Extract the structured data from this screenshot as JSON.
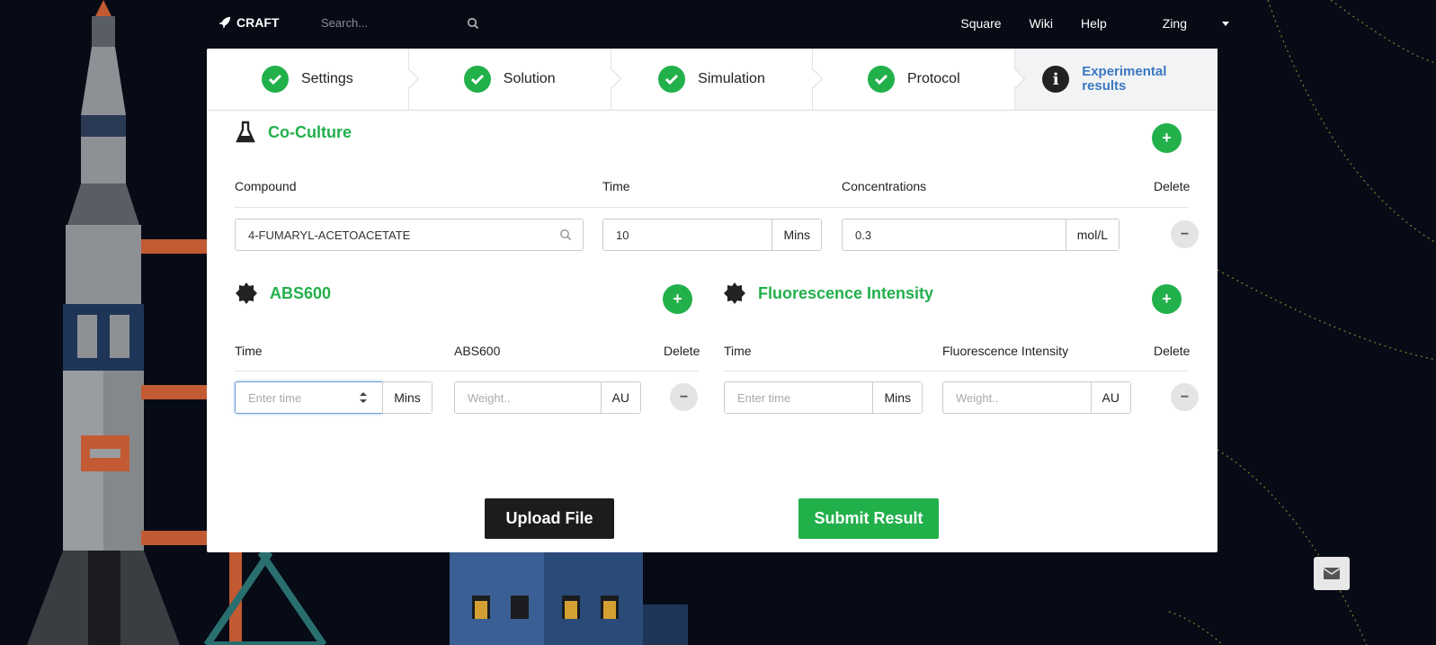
{
  "nav": {
    "brand": "CRAFT",
    "search_placeholder": "Search...",
    "links": [
      "Square",
      "Wiki",
      "Help"
    ],
    "user": "Zing"
  },
  "steps": [
    {
      "label": "Settings",
      "status": "done"
    },
    {
      "label": "Solution",
      "status": "done"
    },
    {
      "label": "Simulation",
      "status": "done"
    },
    {
      "label": "Protocol",
      "status": "done"
    },
    {
      "label_line1": "Experimental",
      "label_line2": "results",
      "status": "active"
    }
  ],
  "coculture": {
    "title": "Co-Culture",
    "headers": {
      "compound": "Compound",
      "time": "Time",
      "concentrations": "Concentrations",
      "delete": "Delete"
    },
    "row": {
      "compound": "4-FUMARYL-ACETOACETATE",
      "time": "10",
      "time_unit": "Mins",
      "concentration": "0.3",
      "concentration_unit": "mol/L"
    }
  },
  "abs600": {
    "title": "ABS600",
    "headers": {
      "time": "Time",
      "value": "ABS600",
      "delete": "Delete"
    },
    "row": {
      "time_placeholder": "Enter time",
      "time_unit": "Mins",
      "value_placeholder": "Weight..",
      "value_unit": "AU"
    }
  },
  "fluorescence": {
    "title": "Fluorescence Intensity",
    "headers": {
      "time": "Time",
      "value": "Fluorescence Intensity",
      "delete": "Delete"
    },
    "row": {
      "time_placeholder": "Enter time",
      "time_unit": "Mins",
      "value_placeholder": "Weight..",
      "value_unit": "AU"
    }
  },
  "actions": {
    "upload": "Upload File",
    "submit": "Submit Result"
  },
  "colors": {
    "accent_green": "#22b04b",
    "active_blue": "#3b78c2",
    "background": "#070b16"
  }
}
